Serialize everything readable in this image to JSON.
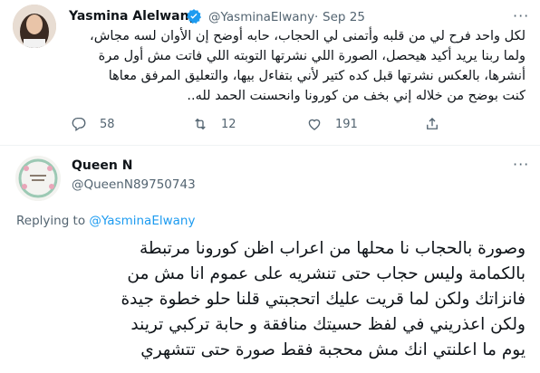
{
  "tweet": {
    "author_name": "Yasmina Alelwany",
    "handle": "@YasminaElwany",
    "separator": "·",
    "date": "Sep 25",
    "more": "···",
    "text_lines": [
      "لكل واحد فرح لي من قلبه وأتمنى لي الحجاب، حابه أوضح إن الأوان لسه مجاش،",
      "ولما ربنا يريد أكيد هيحصل، الصورة اللي نشرتها التوبته اللي فاتت  مش أول مرة",
      "أنشرها، بالعكس نشرتها قبل كده كتير لأني بتفاءل بيها، والتعليق المرفق معاها",
      "كنت بوضح من خلاله إني بخف من كورونا وانحسنت الحمد لله.."
    ],
    "reply_count": "58",
    "retweet_count": "12",
    "like_count": "191"
  },
  "reply": {
    "author_name": "Queen N",
    "handle": "@QueenN89750743",
    "more": "···",
    "replying_to_label": "Replying to",
    "replying_to_handle": "@YasminaElwany",
    "text_lines": [
      "وصورة بالحجاب نا محلها من اعراب اظن كورونا مرتبطة",
      "بالكمامة وليس حجاب حتى تنشريه على عموم انا مش من",
      "فانزاتك ولكن لما قريت عليك اتحجبتي قلنا حلو خطوة جيدة",
      "ولكن اعذريني في لفظ حسيتك منافقة و حابة تركبي تريند",
      "يوم ما اعلنتي انك مش محجبة فقط صورة حتى تتشهري"
    ]
  },
  "colors": {
    "verified": "#1d9bf0",
    "link": "#1d9bf0",
    "muted": "#536471"
  }
}
